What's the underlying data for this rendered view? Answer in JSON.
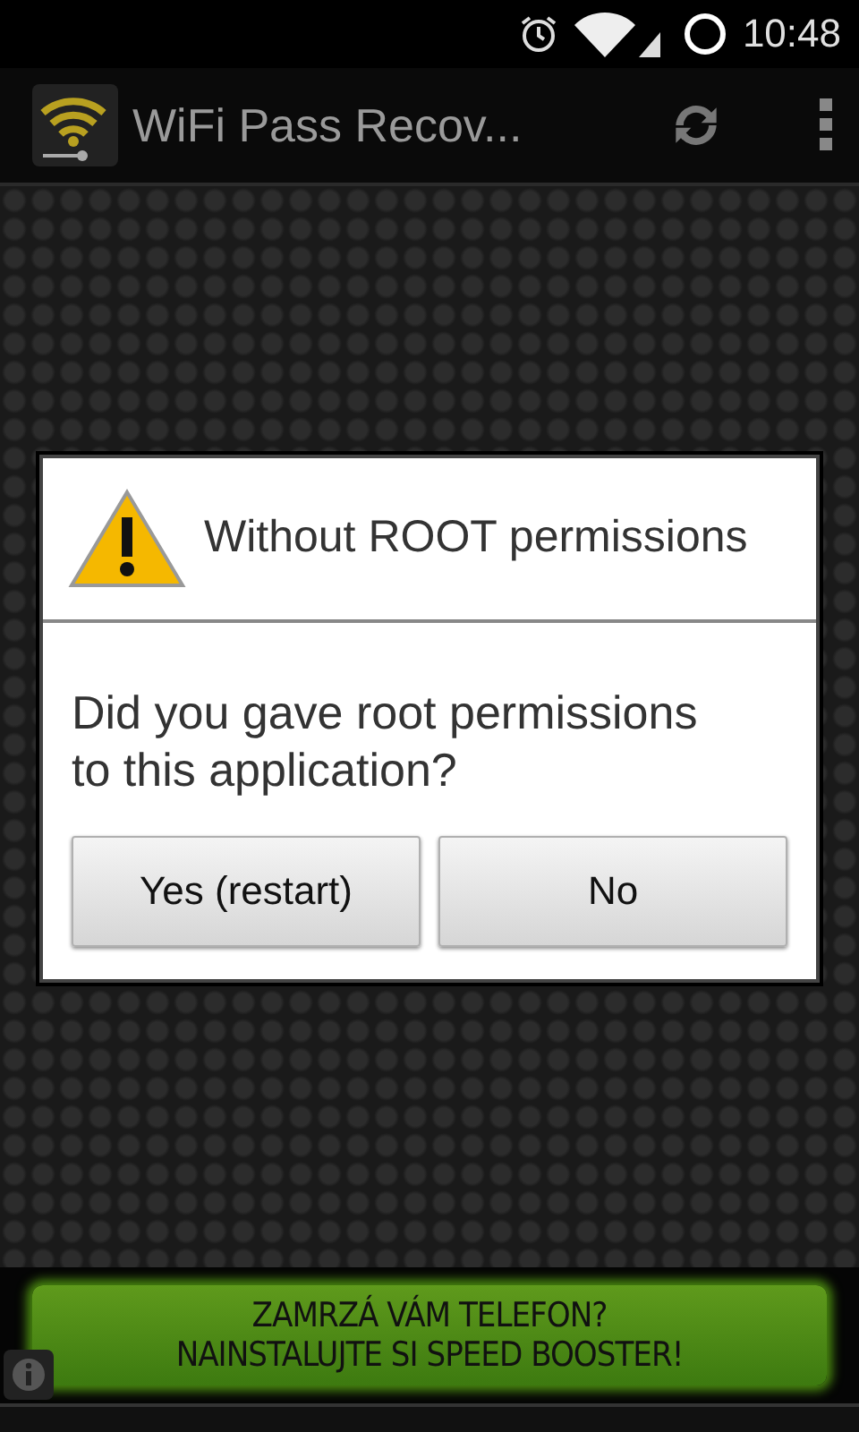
{
  "status_bar": {
    "time": "10:48"
  },
  "action_bar": {
    "title": "WiFi Pass Recov..."
  },
  "dialog": {
    "title": "Without ROOT permissions",
    "message": "Did you gave root permissions to this application?",
    "buttons": [
      "Yes (restart)",
      "No"
    ]
  },
  "ad_banner": {
    "lines": [
      "ZAMRZÁ VÁM TELEFON?",
      "NAINSTALUJTE SI SPEED BOOSTER!"
    ]
  }
}
